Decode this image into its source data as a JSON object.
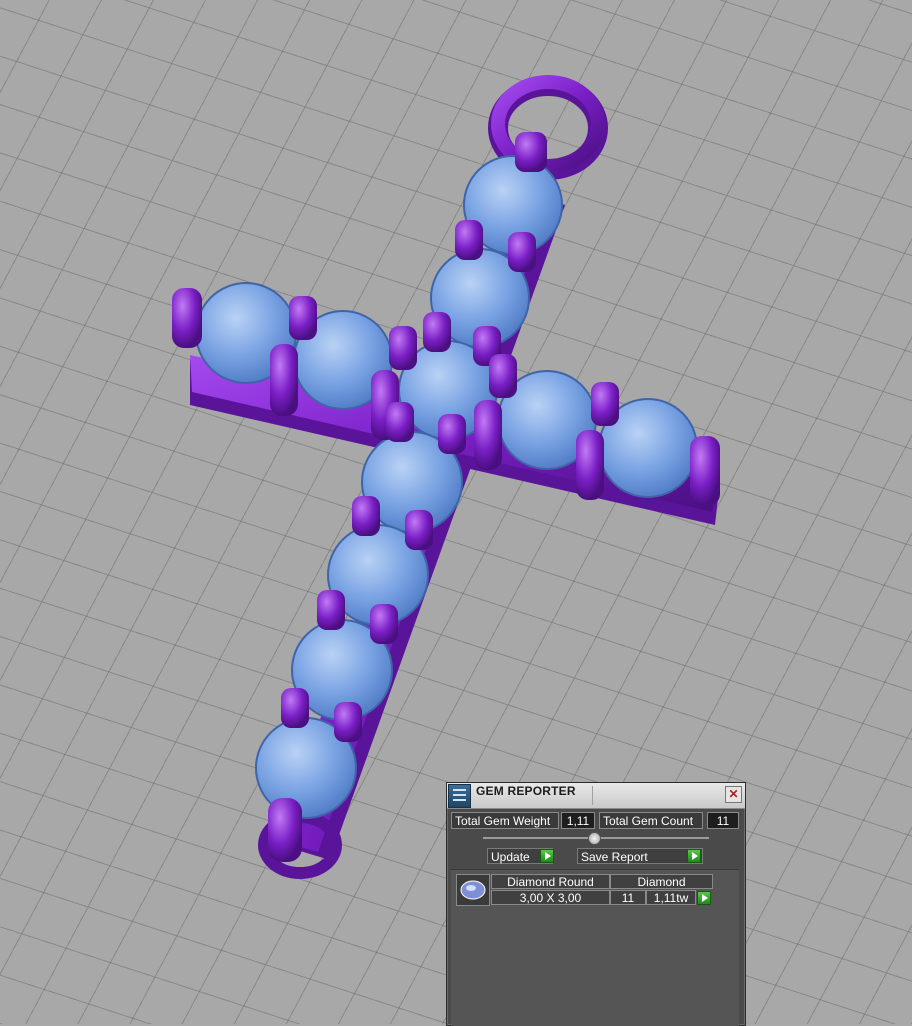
{
  "panel": {
    "title": "GEM REPORTER",
    "close_glyph": "✕",
    "total_gem_weight_label": "Total Gem Weight",
    "total_gem_weight_value": "1,11",
    "total_gem_count_label": "Total Gem Count",
    "total_gem_count_value": "11",
    "update_label": "Update",
    "save_report_label": "Save Report",
    "gem_rows": [
      {
        "name": "Diamond Round",
        "material": "Diamond",
        "size": "3,00 X 3,00",
        "count": "11",
        "weight": "1,11tw"
      }
    ]
  },
  "icons": {
    "app": "gem-reporter-icon",
    "close": "close-icon",
    "action": "play-arrow-icon",
    "gem": "round-gem-icon"
  },
  "colors": {
    "metal": "#7a1fc6",
    "gem": "#6f9be0",
    "grid_background": "#a8a8a8",
    "panel_background": "#4a4a4a",
    "action_green": "#2ea325"
  }
}
